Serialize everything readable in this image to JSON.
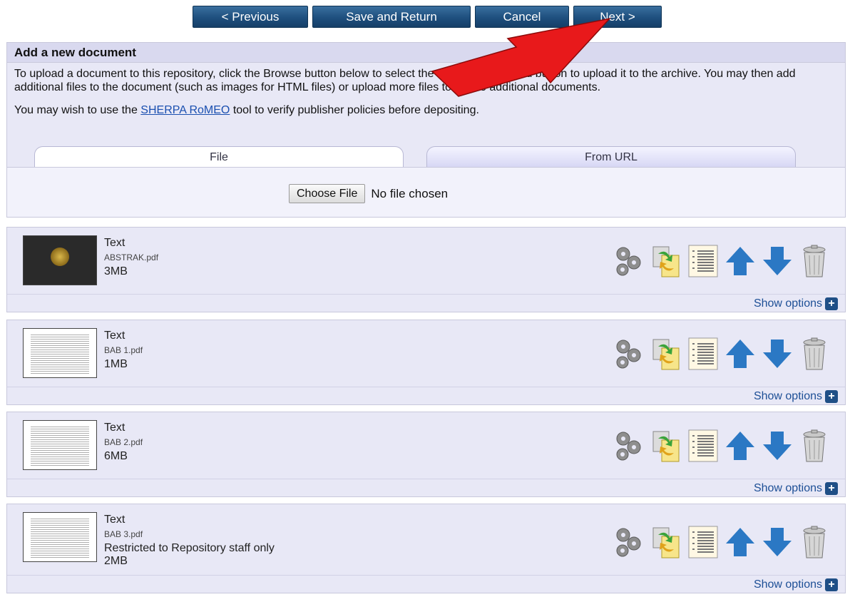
{
  "nav": {
    "previous": "< Previous",
    "save_return": "Save and Return",
    "cancel": "Cancel",
    "next": "Next >"
  },
  "upload": {
    "title": "Add a new document",
    "intro": "To upload a document to this repository, click the Browse button below to select the file and the Upload button to upload it to the archive. You may then add additional files to the document (such as images for HTML files) or upload more files to create additional documents.",
    "intro2_before": "You may wish to use the ",
    "intro2_link": "SHERPA RoMEO",
    "intro2_after": " tool to verify publisher policies before depositing.",
    "tabs": [
      "File",
      "From URL"
    ],
    "choose_label": "Choose File",
    "no_file": "No file chosen"
  },
  "documents": [
    {
      "type": "Text",
      "name": "ABSTRAK.pdf",
      "note": "",
      "size": "3MB"
    },
    {
      "type": "Text",
      "name": "BAB 1.pdf",
      "note": "",
      "size": "1MB"
    },
    {
      "type": "Text",
      "name": "BAB 2.pdf",
      "note": "",
      "size": "6MB"
    },
    {
      "type": "Text",
      "name": "BAB 3.pdf",
      "note": "Restricted to Repository staff only",
      "size": "2MB"
    }
  ],
  "show_options": "Show options",
  "colors": {
    "nav_button": "#1e4f7e",
    "panel_bg": "#e8e8f6",
    "arrow": "#e8191b",
    "move_arrow": "#2b78c4"
  }
}
